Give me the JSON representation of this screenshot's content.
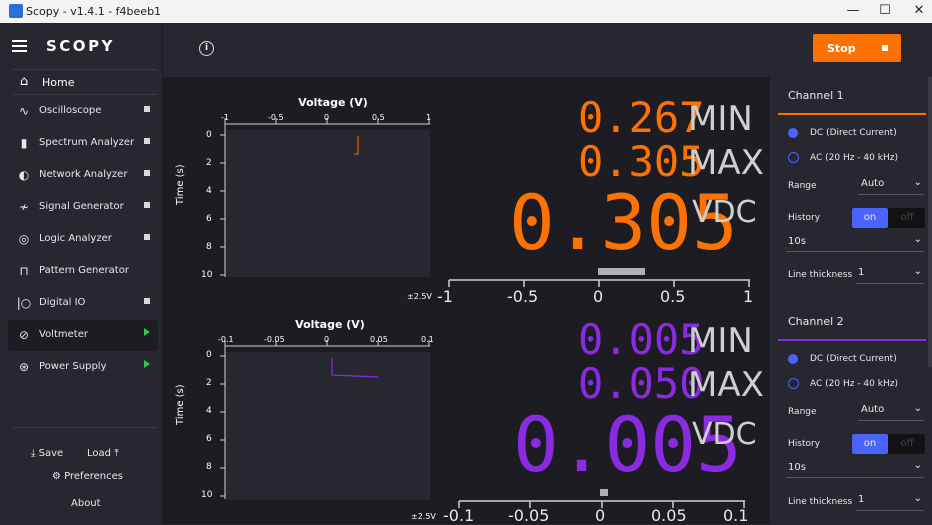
{
  "window": {
    "title": "Scopy - v1.4.1 - f4beeb1",
    "minimize": "—",
    "maximize": "☐",
    "close": "✕"
  },
  "sidebar": {
    "logo": "SCOPY",
    "home": "Home",
    "items": [
      {
        "label": "Oscilloscope",
        "icon": "oscilloscope-icon",
        "state": "stopped"
      },
      {
        "label": "Spectrum Analyzer",
        "icon": "spectrum-icon",
        "state": "stopped"
      },
      {
        "label": "Network Analyzer",
        "icon": "network-icon",
        "state": "stopped"
      },
      {
        "label": "Signal Generator",
        "icon": "signal-icon",
        "state": "stopped"
      },
      {
        "label": "Logic Analyzer",
        "icon": "logic-icon",
        "state": "stopped"
      },
      {
        "label": "Pattern Generator",
        "icon": "pattern-icon",
        "state": "none"
      },
      {
        "label": "Digital IO",
        "icon": "digitalio-icon",
        "state": "stopped"
      },
      {
        "label": "Voltmeter",
        "icon": "voltmeter-icon",
        "state": "running"
      },
      {
        "label": "Power Supply",
        "icon": "power-icon",
        "state": "running"
      }
    ],
    "save": "Save",
    "load": "Load",
    "preferences": "Preferences",
    "about": "About"
  },
  "toolbar": {
    "run_label": "Stop",
    "accent": "#ff7200"
  },
  "channels": [
    {
      "color": "#ff7200",
      "plot": {
        "title": "Voltage (V)",
        "ylabel": "Time (s)",
        "x_ticks": [
          "-1",
          "-0.5",
          "0",
          "0.5",
          "1"
        ],
        "y_ticks": [
          "0",
          "2",
          "4",
          "6",
          "8",
          "10"
        ],
        "range_label": "±2.5V"
      },
      "min": "0.267",
      "min_label": "MIN",
      "max": "0.305",
      "max_label": "MAX",
      "value": "0.305",
      "unit": "VDC",
      "bar": {
        "ticks": [
          "-1",
          "-0.5",
          "0",
          "0.5",
          "1"
        ]
      }
    },
    {
      "color": "#8a2be2",
      "plot": {
        "title": "Voltage (V)",
        "ylabel": "Time (s)",
        "x_ticks": [
          "-0.1",
          "-0.05",
          "0",
          "0.05",
          "0.1"
        ],
        "y_ticks": [
          "0",
          "2",
          "4",
          "6",
          "8",
          "10"
        ],
        "range_label": "±2.5V"
      },
      "min": "0.005",
      "min_label": "MIN",
      "max": "0.050",
      "max_label": "MAX",
      "value": "0.005",
      "unit": "VDC",
      "bar": {
        "ticks": [
          "-0.1",
          "-0.05",
          "0",
          "0.05",
          "0.1"
        ]
      }
    }
  ],
  "settings": [
    {
      "title": "Channel 1",
      "color": "#ff7200",
      "dc": "DC (Direct Current)",
      "ac": "AC (20 Hz - 40 kHz)",
      "range_label": "Range",
      "range_value": "Auto",
      "history_label": "History",
      "history_on": "on",
      "history_off": "off",
      "history_value": "10s",
      "thickness_label": "Line thickness",
      "thickness_value": "1"
    },
    {
      "title": "Channel 2",
      "color": "#8a2be2",
      "dc": "DC (Direct Current)",
      "ac": "AC (20 Hz - 40 kHz)",
      "range_label": "Range",
      "range_value": "Auto",
      "history_label": "History",
      "history_on": "on",
      "history_off": "off",
      "history_value": "10s",
      "thickness_label": "Line thickness",
      "thickness_value": "1"
    }
  ]
}
